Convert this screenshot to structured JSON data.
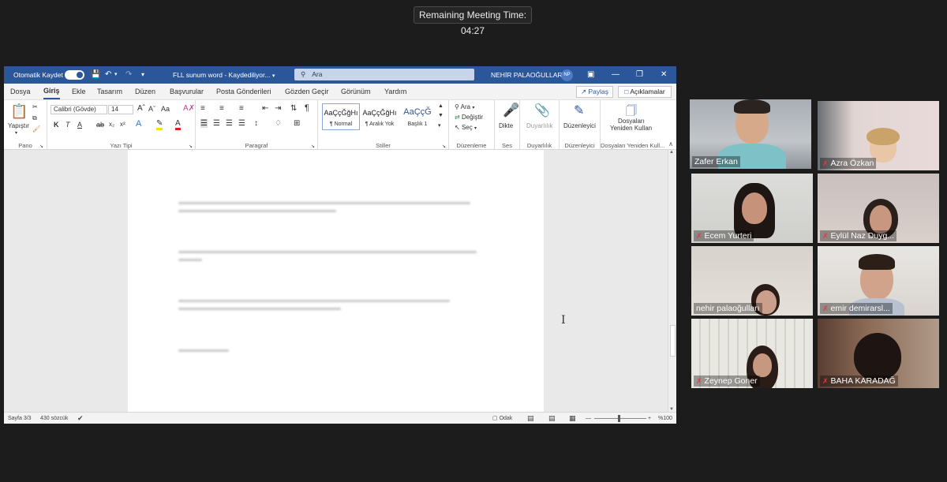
{
  "meeting": {
    "remaining": "Remaining Meeting Time: 04:27"
  },
  "word": {
    "titlebar": {
      "autosave": "Otomatik Kaydet",
      "doc_title": "FLL sunum word  -  Kaydediliyor...",
      "search_placeholder": "Ara",
      "user_name": "NEHİR PALAOĞULLARI",
      "user_initials": "NP"
    },
    "menu": [
      "Dosya",
      "Giriş",
      "Ekle",
      "Tasarım",
      "Düzen",
      "Başvurular",
      "Posta Gönderileri",
      "Gözden Geçir",
      "Görünüm",
      "Yardım"
    ],
    "share_label": "Paylaş",
    "comments_label": "Açıklamalar",
    "ribbon": {
      "pano": {
        "label": "Pano",
        "paste": "Yapıştır"
      },
      "font": {
        "label": "Yazı Tipi",
        "name": "Calibri (Gövde)",
        "size": "14"
      },
      "paragraph": {
        "label": "Paragraf"
      },
      "styles": {
        "label": "Stiller",
        "items": [
          {
            "sample": "AaÇçĞğHı",
            "name": "¶ Normal"
          },
          {
            "sample": "AaÇçĞğHı",
            "name": "¶ Aralık Yok"
          },
          {
            "sample": "AaÇçĞ",
            "name": "Başlık 1"
          }
        ]
      },
      "editing": {
        "label": "Düzenleme",
        "find": "Ara",
        "replace": "Değiştir",
        "select": "Seç"
      },
      "voice": {
        "label": "Ses",
        "dictate": "Dikte"
      },
      "sensitivity": {
        "label": "Duyarlılık",
        "button": "Duyarlılık"
      },
      "editor": {
        "label": "Düzenleyici",
        "button": "Düzenleyici"
      },
      "reuse": {
        "label": "Dosyaları Yeniden Kull...",
        "button_line1": "Dosyaları",
        "button_line2": "Yeniden Kullan"
      }
    },
    "status": {
      "page": "Sayfa 3/3",
      "words": "430 sözcük",
      "focus": "Odak",
      "zoom": "%100"
    }
  },
  "participants": [
    {
      "name": "Zafer Erkan",
      "muted": false,
      "active": true
    },
    {
      "name": "Azra Özkan",
      "muted": true,
      "active": false
    },
    {
      "name": "Ecem Yurteri",
      "muted": true,
      "active": false
    },
    {
      "name": "Eylül Naz Duyg...",
      "muted": true,
      "active": false
    },
    {
      "name": "nehir palaoğulları",
      "muted": false,
      "active": false
    },
    {
      "name": "emir demirarsl...",
      "muted": true,
      "active": false
    },
    {
      "name": "Zeynep Goner",
      "muted": true,
      "active": false
    },
    {
      "name": "BAHA KARADAĞ",
      "muted": true,
      "active": false
    }
  ]
}
